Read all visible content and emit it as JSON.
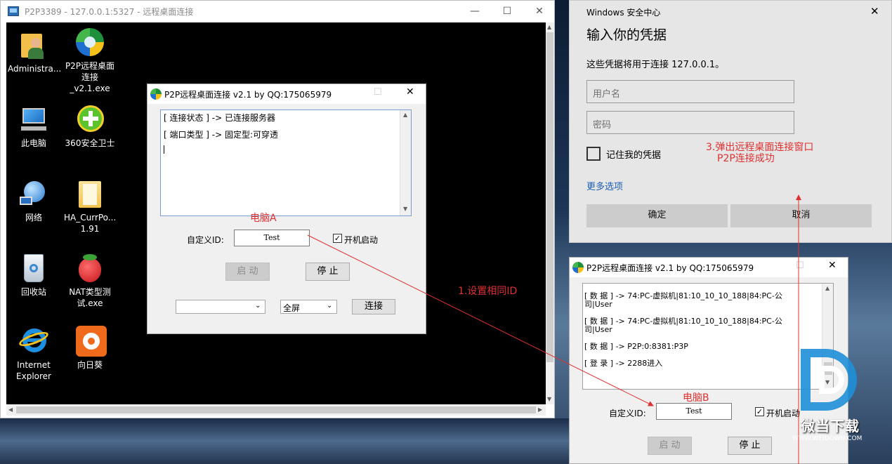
{
  "rdp_window": {
    "title": "P2P3389 - 127.0.0.1:5327 - 远程桌面连接",
    "minimize": "—",
    "maximize": "☐",
    "close": "✕"
  },
  "desktop_icons": [
    {
      "label": "Administra...",
      "icon": "user-folder-icon"
    },
    {
      "label": "P2P远程桌面连接_v2.1.exe",
      "icon": "p2p-app-icon"
    },
    {
      "label": "此电脑",
      "icon": "computer-icon"
    },
    {
      "label": "360安全卫士",
      "icon": "360-security-icon"
    },
    {
      "label": "网络",
      "icon": "network-icon"
    },
    {
      "label": "HA_CurrPo... 1.91",
      "icon": "folder-icon"
    },
    {
      "label": "回收站",
      "icon": "recycle-bin-icon"
    },
    {
      "label": "NAT类型测试.exe",
      "icon": "strawberry-icon"
    },
    {
      "label": "Internet Explorer",
      "icon": "ie-icon"
    },
    {
      "label": "向日葵",
      "icon": "sunflower-icon"
    }
  ],
  "dialog_a": {
    "title": "P2P远程桌面连接 v2.1 by QQ:175065979",
    "log_lines": [
      "[ 连接状态 ] -> 已连接服务器",
      "[ 端口类型 ] -> 固定型:可穿透"
    ],
    "caption": "电脑A",
    "id_label": "自定义ID:",
    "id_value": "Test",
    "autostart_label": "开机启动",
    "start_btn": "启 动",
    "stop_btn": "停 止",
    "display_mode": "全屏",
    "connect_btn": "连接"
  },
  "security_dialog": {
    "app": "Windows 安全中心",
    "heading": "输入你的凭据",
    "message": "这些凭据将用于连接 127.0.0.1。",
    "username_placeholder": "用户名",
    "password_placeholder": "密码",
    "remember_label": "记住我的凭据",
    "more_options": "更多选项",
    "ok_btn": "确定",
    "cancel_btn": "取消",
    "close": "✕"
  },
  "annotations": {
    "step1": "1.设置相同ID",
    "step3_line1": "3.弹出远程桌面连接窗口",
    "step3_line2": "P2P连接成功"
  },
  "dialog_b": {
    "title": "P2P远程桌面连接 v2.1 by QQ:175065979",
    "log_lines": [
      "[ 数  据 ] -> 74:PC-虚拟机|81:10_10_10_188|84:PC-公",
      "司|User",
      "[ 数  据 ] -> 74:PC-虚拟机|81:10_10_10_188|84:PC-公",
      "司|User",
      "[ 数  据 ] -> P2P:0:8381:P3P",
      "[ 登  录 ] -> 2288进入"
    ],
    "caption": "电脑B",
    "id_label": "自定义ID:",
    "id_value": "Test",
    "autostart_label": "开机启动",
    "start_btn": "启 动",
    "stop_btn": "停 止"
  },
  "watermark": {
    "text": "微当下载",
    "url": "WWW.WEIDOWN.COM"
  },
  "colors": {
    "annotation_red": "#e03030",
    "link_blue": "#1a5fb4",
    "desktop_bg": "#000000"
  }
}
